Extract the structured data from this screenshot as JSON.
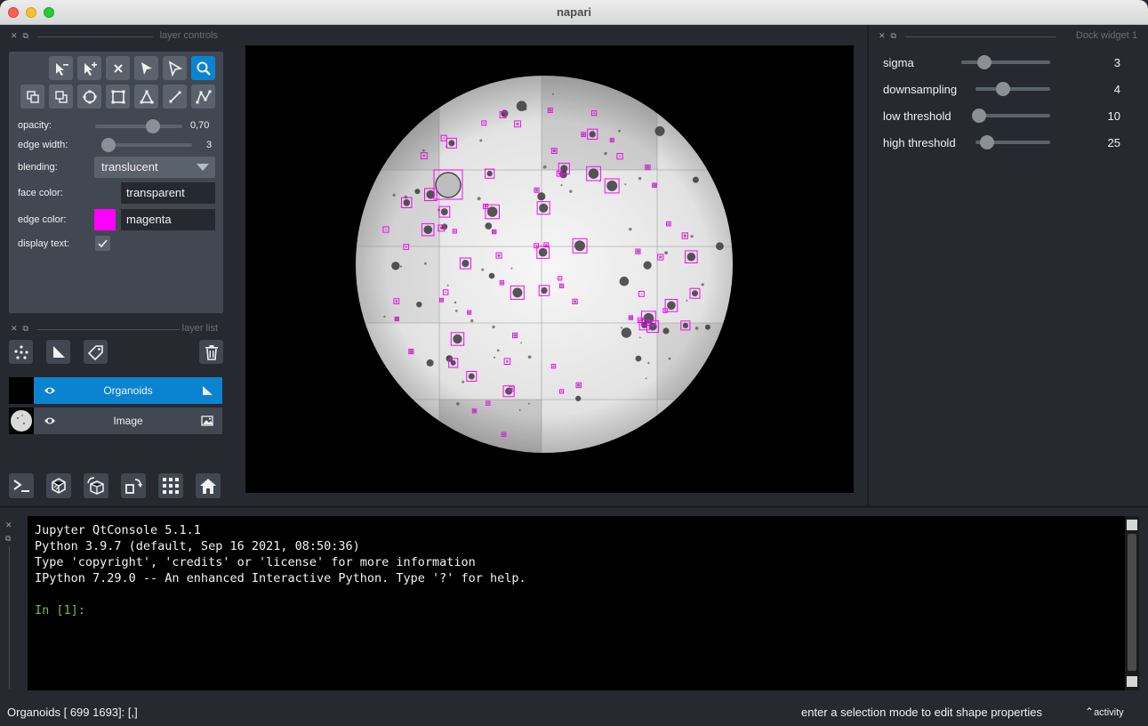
{
  "window": {
    "title": "napari"
  },
  "layer_controls": {
    "header": "layer controls",
    "opacity": {
      "label": "opacity:",
      "value": "0,70",
      "level": 0.7
    },
    "edge_width": {
      "label": "edge width:",
      "value": "3"
    },
    "blending": {
      "label": "blending:",
      "value": "translucent"
    },
    "face_color": {
      "label": "face color:",
      "value": "transparent"
    },
    "edge_color": {
      "label": "edge color:",
      "value": "magenta",
      "swatch": "#ff00ff"
    },
    "display_text": {
      "label": "display text:",
      "checked": true
    },
    "tools": [
      "remove-vertex-icon",
      "add-vertex-icon",
      "delete-shape-icon",
      "select-shape-icon",
      "direct-select-icon",
      "pan-zoom-icon",
      "move-back-icon",
      "move-front-icon",
      "ellipse-icon",
      "rectangle-icon",
      "polygon-icon",
      "line-icon",
      "path-icon"
    ]
  },
  "layer_list": {
    "header": "layer list",
    "layers": [
      {
        "name": "Organoids",
        "selected": true,
        "visible": true,
        "type_icon": "shapes-icon"
      },
      {
        "name": "Image",
        "selected": false,
        "visible": true,
        "type_icon": "image-icon"
      }
    ]
  },
  "dock_widget": {
    "header": "Dock widget 1",
    "params": [
      {
        "label": "sigma",
        "value": "3"
      },
      {
        "label": "downsampling",
        "value": "4"
      },
      {
        "label": "low threshold",
        "value": "10"
      },
      {
        "label": "high threshold",
        "value": "25"
      }
    ]
  },
  "console": {
    "lines": [
      "Jupyter QtConsole 5.1.1",
      "Python 3.9.7 (default, Sep 16 2021, 08:50:36)",
      "Type 'copyright', 'credits' or 'license' for more information",
      "IPython 7.29.0 -- An enhanced Interactive Python. Type '?' for help."
    ],
    "prompt": "In [1]:"
  },
  "status": {
    "left": "Organoids [ 699 1693]: [,]",
    "right": "enter a selection mode to edit shape properties",
    "activity": "activity"
  },
  "colors": {
    "accent": "#0a84d0",
    "shape_edge": "#ff00ff",
    "background": "#262930",
    "panel": "#414851"
  }
}
